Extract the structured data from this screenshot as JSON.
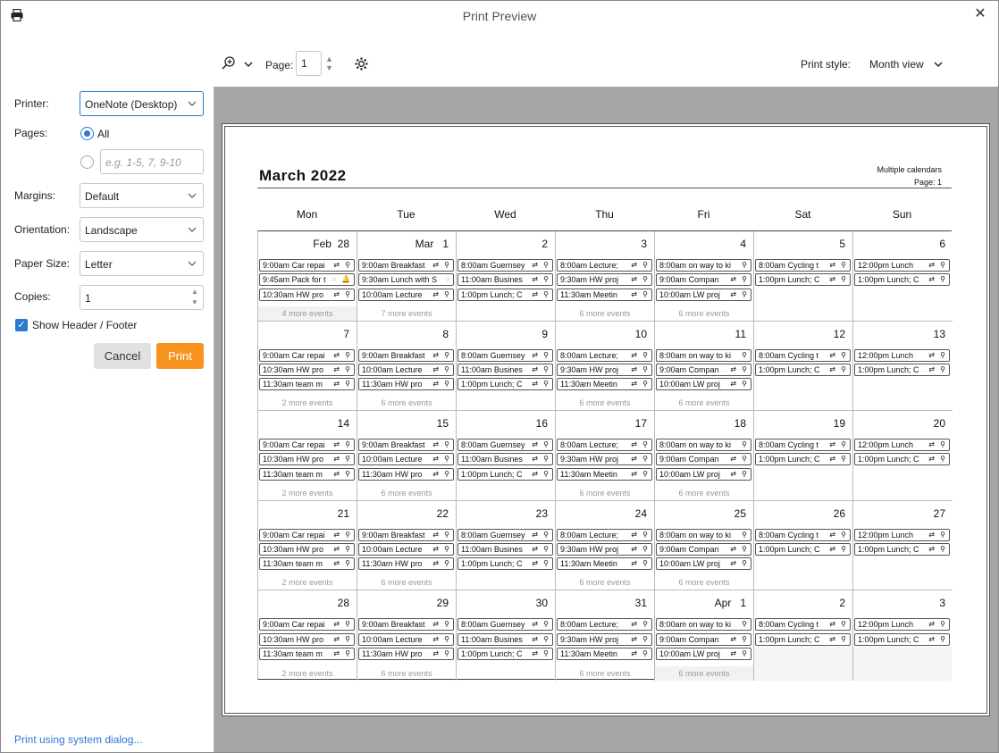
{
  "window": {
    "title": "Print Preview",
    "close": "✕"
  },
  "sidebar": {
    "printer_label": "Printer:",
    "printer_value": "OneNote (Desktop)",
    "pages_label": "Pages:",
    "pages_all": "All",
    "pages_placeholder": "e.g. 1-5, 7, 9-10",
    "margins_label": "Margins:",
    "margins_value": "Default",
    "orientation_label": "Orientation:",
    "orientation_value": "Landscape",
    "paper_label": "Paper Size:",
    "paper_value": "Letter",
    "copies_label": "Copies:",
    "copies_value": "1",
    "header_footer_label": "Show Header / Footer",
    "cancel": "Cancel",
    "print": "Print",
    "system_dialog": "Print using system dialog..."
  },
  "toolbar": {
    "page_label": "Page:",
    "page_value": "1",
    "style_label": "Print style:",
    "style_value": "Month view"
  },
  "preview": {
    "title": "March 2022",
    "header_right_1": "Multiple calendars",
    "header_right_2": "Page: 1",
    "dow": [
      "Mon",
      "Tue",
      "Wed",
      "Thu",
      "Fri",
      "Sat",
      "Sun"
    ],
    "weeks": [
      [
        {
          "day": "Feb  28",
          "events": [
            [
              "9:00am Car repai",
              "⇄ ⚲"
            ],
            [
              "9:45am Pack for t",
              "◌ 🔔"
            ],
            [
              "10:30am HW pro",
              "⇄ ⚲"
            ]
          ],
          "more": "4 more events",
          "shade": true
        },
        {
          "day": "Mar   1",
          "events": [
            [
              "9:00am Breakfast",
              "⇄ ⚲"
            ],
            [
              "9:30am Lunch with S",
              "◌"
            ],
            [
              "10:00am Lecture",
              "⇄ ⚲"
            ]
          ],
          "more": "7 more events"
        },
        {
          "day": "2",
          "events": [
            [
              "8:00am Guernsey",
              "⇄ ⚲"
            ],
            [
              "11:00am Busines",
              "⇄ ⚲"
            ],
            [
              "1:00pm Lunch; C",
              "⇄ ⚲"
            ]
          ],
          "more": ""
        },
        {
          "day": "3",
          "events": [
            [
              "8:00am Lecture;",
              "⇄ ⚲"
            ],
            [
              "9:30am HW proj",
              "⇄ ⚲"
            ],
            [
              "11:30am Meetin",
              "⇄ ⚲"
            ]
          ],
          "more": "6 more events"
        },
        {
          "day": "4",
          "events": [
            [
              "8:00am on way to ki",
              "⚲"
            ],
            [
              "9:00am Compan",
              "⇄ ⚲"
            ],
            [
              "10:00am LW proj",
              "⇄ ⚲"
            ]
          ],
          "more": "6 more events"
        },
        {
          "day": "5",
          "events": [
            [
              "8:00am Cycling t",
              "⇄ ⚲"
            ],
            [
              "1:00pm Lunch; C",
              "⇄ ⚲"
            ]
          ],
          "more": ""
        },
        {
          "day": "6",
          "events": [
            [
              "12:00pm Lunch",
              "⇄ ⚲"
            ],
            [
              "1:00pm Lunch; C",
              "⇄ ⚲"
            ]
          ],
          "more": ""
        }
      ],
      [
        {
          "day": "7",
          "events": [
            [
              "9:00am Car repai",
              "⇄ ⚲"
            ],
            [
              "10:30am HW pro",
              "⇄ ⚲"
            ],
            [
              "11:30am team m",
              "⇄ ⚲"
            ]
          ],
          "more": "2 more events"
        },
        {
          "day": "8",
          "events": [
            [
              "9:00am Breakfast",
              "⇄ ⚲"
            ],
            [
              "10:00am Lecture",
              "⇄ ⚲"
            ],
            [
              "11:30am HW pro",
              "⇄ ⚲"
            ]
          ],
          "more": "6 more events"
        },
        {
          "day": "9",
          "events": [
            [
              "8:00am Guernsey",
              "⇄ ⚲"
            ],
            [
              "11:00am Busines",
              "⇄ ⚲"
            ],
            [
              "1:00pm Lunch; C",
              "⇄ ⚲"
            ]
          ],
          "more": ""
        },
        {
          "day": "10",
          "events": [
            [
              "8:00am Lecture;",
              "⇄ ⚲"
            ],
            [
              "9:30am HW proj",
              "⇄ ⚲"
            ],
            [
              "11:30am Meetin",
              "⇄ ⚲"
            ]
          ],
          "more": "6 more events"
        },
        {
          "day": "11",
          "events": [
            [
              "8:00am on way to ki",
              "⚲"
            ],
            [
              "9:00am Compan",
              "⇄ ⚲"
            ],
            [
              "10:00am LW proj",
              "⇄ ⚲"
            ]
          ],
          "more": "6 more events"
        },
        {
          "day": "12",
          "events": [
            [
              "8:00am Cycling t",
              "⇄ ⚲"
            ],
            [
              "1:00pm Lunch; C",
              "⇄ ⚲"
            ]
          ],
          "more": ""
        },
        {
          "day": "13",
          "events": [
            [
              "12:00pm Lunch",
              "⇄ ⚲"
            ],
            [
              "1:00pm Lunch; C",
              "⇄ ⚲"
            ]
          ],
          "more": ""
        }
      ],
      [
        {
          "day": "14",
          "events": [
            [
              "9:00am Car repai",
              "⇄ ⚲"
            ],
            [
              "10:30am HW pro",
              "⇄ ⚲"
            ],
            [
              "11:30am team m",
              "⇄ ⚲"
            ]
          ],
          "more": "2 more events"
        },
        {
          "day": "15",
          "events": [
            [
              "9:00am Breakfast",
              "⇄ ⚲"
            ],
            [
              "10:00am Lecture",
              "⇄ ⚲"
            ],
            [
              "11:30am HW pro",
              "⇄ ⚲"
            ]
          ],
          "more": "6 more events"
        },
        {
          "day": "16",
          "events": [
            [
              "8:00am Guernsey",
              "⇄ ⚲"
            ],
            [
              "11:00am Busines",
              "⇄ ⚲"
            ],
            [
              "1:00pm Lunch; C",
              "⇄ ⚲"
            ]
          ],
          "more": ""
        },
        {
          "day": "17",
          "events": [
            [
              "8:00am Lecture;",
              "⇄ ⚲"
            ],
            [
              "9:30am HW proj",
              "⇄ ⚲"
            ],
            [
              "11:30am Meetin",
              "⇄ ⚲"
            ]
          ],
          "more": "6 more events"
        },
        {
          "day": "18",
          "events": [
            [
              "8:00am on way to ki",
              "⚲"
            ],
            [
              "9:00am Compan",
              "⇄ ⚲"
            ],
            [
              "10:00am LW proj",
              "⇄ ⚲"
            ]
          ],
          "more": "6 more events"
        },
        {
          "day": "19",
          "events": [
            [
              "8:00am Cycling t",
              "⇄ ⚲"
            ],
            [
              "1:00pm Lunch; C",
              "⇄ ⚲"
            ]
          ],
          "more": ""
        },
        {
          "day": "20",
          "events": [
            [
              "12:00pm Lunch",
              "⇄ ⚲"
            ],
            [
              "1:00pm Lunch; C",
              "⇄ ⚲"
            ]
          ],
          "more": ""
        }
      ],
      [
        {
          "day": "21",
          "events": [
            [
              "9:00am Car repai",
              "⇄ ⚲"
            ],
            [
              "10:30am HW pro",
              "⇄ ⚲"
            ],
            [
              "11:30am team m",
              "⇄ ⚲"
            ]
          ],
          "more": "2 more events"
        },
        {
          "day": "22",
          "events": [
            [
              "9:00am Breakfast",
              "⇄ ⚲"
            ],
            [
              "10:00am Lecture",
              "⇄ ⚲"
            ],
            [
              "11:30am HW pro",
              "⇄ ⚲"
            ]
          ],
          "more": "6 more events"
        },
        {
          "day": "23",
          "events": [
            [
              "8:00am Guernsey",
              "⇄ ⚲"
            ],
            [
              "11:00am Busines",
              "⇄ ⚲"
            ],
            [
              "1:00pm Lunch; C",
              "⇄ ⚲"
            ]
          ],
          "more": ""
        },
        {
          "day": "24",
          "events": [
            [
              "8:00am Lecture;",
              "⇄ ⚲"
            ],
            [
              "9:30am HW proj",
              "⇄ ⚲"
            ],
            [
              "11:30am Meetin",
              "⇄ ⚲"
            ]
          ],
          "more": "6 more events"
        },
        {
          "day": "25",
          "events": [
            [
              "8:00am on way to ki",
              "⚲"
            ],
            [
              "9:00am Compan",
              "⇄ ⚲"
            ],
            [
              "10:00am LW proj",
              "⇄ ⚲"
            ]
          ],
          "more": "6 more events"
        },
        {
          "day": "26",
          "events": [
            [
              "8:00am Cycling t",
              "⇄ ⚲"
            ],
            [
              "1:00pm Lunch; C",
              "⇄ ⚲"
            ]
          ],
          "more": ""
        },
        {
          "day": "27",
          "events": [
            [
              "12:00pm Lunch",
              "⇄ ⚲"
            ],
            [
              "1:00pm Lunch; C",
              "⇄ ⚲"
            ]
          ],
          "more": ""
        }
      ],
      [
        {
          "day": "28",
          "events": [
            [
              "9:00am Car repai",
              "⇄ ⚲"
            ],
            [
              "10:30am HW pro",
              "⇄ ⚲"
            ],
            [
              "11:30am team m",
              "⇄ ⚲"
            ]
          ],
          "more": "2 more events"
        },
        {
          "day": "29",
          "events": [
            [
              "9:00am Breakfast",
              "⇄ ⚲"
            ],
            [
              "10:00am Lecture",
              "⇄ ⚲"
            ],
            [
              "11:30am HW pro",
              "⇄ ⚲"
            ]
          ],
          "more": "6 more events"
        },
        {
          "day": "30",
          "events": [
            [
              "8:00am Guernsey",
              "⇄ ⚲"
            ],
            [
              "11:00am Busines",
              "⇄ ⚲"
            ],
            [
              "1:00pm Lunch; C",
              "⇄ ⚲"
            ]
          ],
          "more": ""
        },
        {
          "day": "31",
          "events": [
            [
              "8:00am Lecture;",
              "⇄ ⚲"
            ],
            [
              "9:30am HW proj",
              "⇄ ⚲"
            ],
            [
              "11:30am Meetin",
              "⇄ ⚲"
            ]
          ],
          "more": "6 more events"
        },
        {
          "day": "Apr   1",
          "events": [
            [
              "8:00am on way to ki",
              "⚲"
            ],
            [
              "9:00am Compan",
              "⇄ ⚲"
            ],
            [
              "10:00am LW proj",
              "⇄ ⚲"
            ]
          ],
          "more": "6 more events",
          "shade": true
        },
        {
          "day": "2",
          "events": [
            [
              "8:00am Cycling t",
              "⇄ ⚲"
            ],
            [
              "1:00pm Lunch; C",
              "⇄ ⚲"
            ]
          ],
          "more": "",
          "shade": true
        },
        {
          "day": "3",
          "events": [
            [
              "12:00pm Lunch",
              "⇄ ⚲"
            ],
            [
              "1:00pm Lunch; C",
              "⇄ ⚲"
            ]
          ],
          "more": "",
          "shade": true
        }
      ]
    ]
  }
}
